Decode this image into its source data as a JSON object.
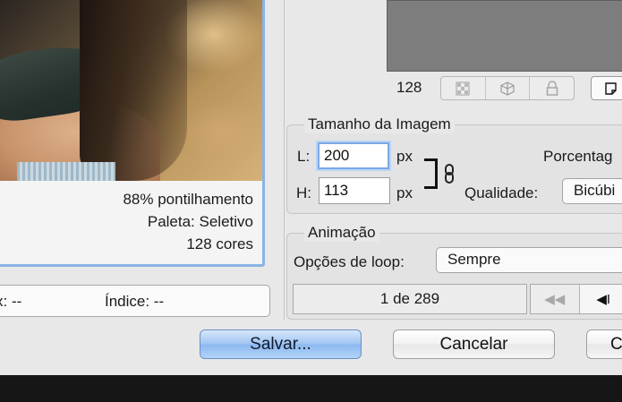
{
  "preview": {
    "dither_info": "88% pontilhamento",
    "palette_info": "Paleta: Seletivo",
    "colors_info": "128 cores"
  },
  "status": {
    "partial_label": "x: --",
    "index_label": "Índice: --"
  },
  "right_preview": {
    "zoom_value": "128"
  },
  "image_size": {
    "title": "Tamanho da Imagem",
    "width_label": "L:",
    "width_value": "200",
    "width_unit": "px",
    "height_label": "H:",
    "height_value": "113",
    "height_unit": "px",
    "percent_label": "Porcentag",
    "quality_label": "Qualidade:",
    "quality_value": "Bicúbi"
  },
  "animation": {
    "title": "Animação",
    "loop_label": "Opções de loop:",
    "loop_value": "Sempre",
    "frame_counter": "1 de 289",
    "first_frame_glyph": "◀◀",
    "prev_frame_glyph": "◀I"
  },
  "buttons": {
    "save": "Salvar...",
    "cancel": "Cancelar",
    "third_partial": "C"
  },
  "colors": {
    "accent_focus": "#7ca9e6",
    "default_button": "#9fc4f2"
  }
}
